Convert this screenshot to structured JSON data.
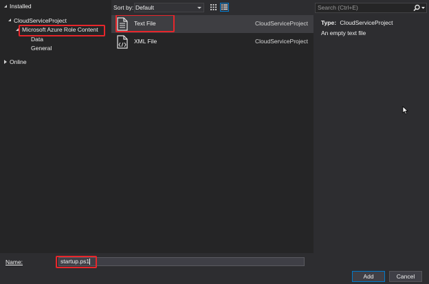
{
  "tree": {
    "installed": "Installed",
    "project": "CloudServiceProject",
    "azure": "Microsoft Azure Role Content",
    "data": "Data",
    "general": "General",
    "online": "Online"
  },
  "toolbar": {
    "sort_label": "Sort by:",
    "sort_value": "Default"
  },
  "templates": [
    {
      "name": "Text File",
      "tag": "CloudServiceProject",
      "icon": "text-file-icon",
      "selected": true
    },
    {
      "name": "XML File",
      "tag": "CloudServiceProject",
      "icon": "xml-file-icon",
      "selected": false
    }
  ],
  "search": {
    "placeholder": "Search (Ctrl+E)"
  },
  "details": {
    "type_label": "Type:",
    "type_value": "CloudServiceProject",
    "description": "An empty text file"
  },
  "form": {
    "name_label": "Name:",
    "name_value": "startup.ps1"
  },
  "buttons": {
    "add": "Add",
    "cancel": "Cancel"
  },
  "colors": {
    "highlight": "#e8262b",
    "accent": "#007acc",
    "background": "#2d2d30"
  }
}
